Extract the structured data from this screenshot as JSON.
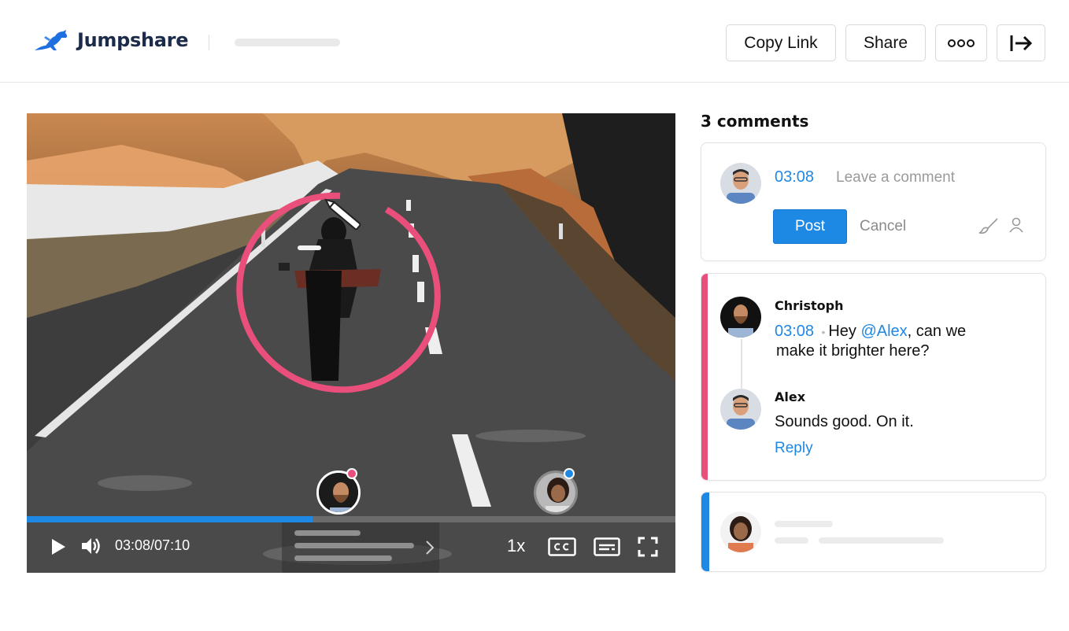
{
  "app": {
    "name": "Jumpshare"
  },
  "header": {
    "copy_link_label": "Copy Link",
    "share_label": "Share",
    "more_icon": "more-dots-icon",
    "exit_icon": "exit-arrow-icon"
  },
  "player": {
    "time_display": "03:08/07:10",
    "speed_label": "1x",
    "progress": 0.44,
    "icons": [
      "play-icon",
      "volume-icon",
      "cc-icon",
      "subtitles-icon",
      "fullscreen-icon"
    ]
  },
  "comments": {
    "header": "3 comments",
    "new_comment": {
      "timestamp": "03:08",
      "placeholder": "Leave a comment",
      "post_label": "Post",
      "cancel_label": "Cancel"
    },
    "thread": {
      "author": "Christoph",
      "timestamp": "03:08",
      "text_before": "Hey ",
      "mention": "@Alex",
      "text_after": ", can we",
      "text_line2": "make it brighter here?",
      "reply_author": "Alex",
      "reply_text": "Sounds good. On it.",
      "reply_label": "Reply"
    }
  },
  "colors": {
    "accent_blue": "#1e88e5",
    "annotation_pink": "#ea4f7c",
    "brand_navy": "#1c2b4a"
  }
}
